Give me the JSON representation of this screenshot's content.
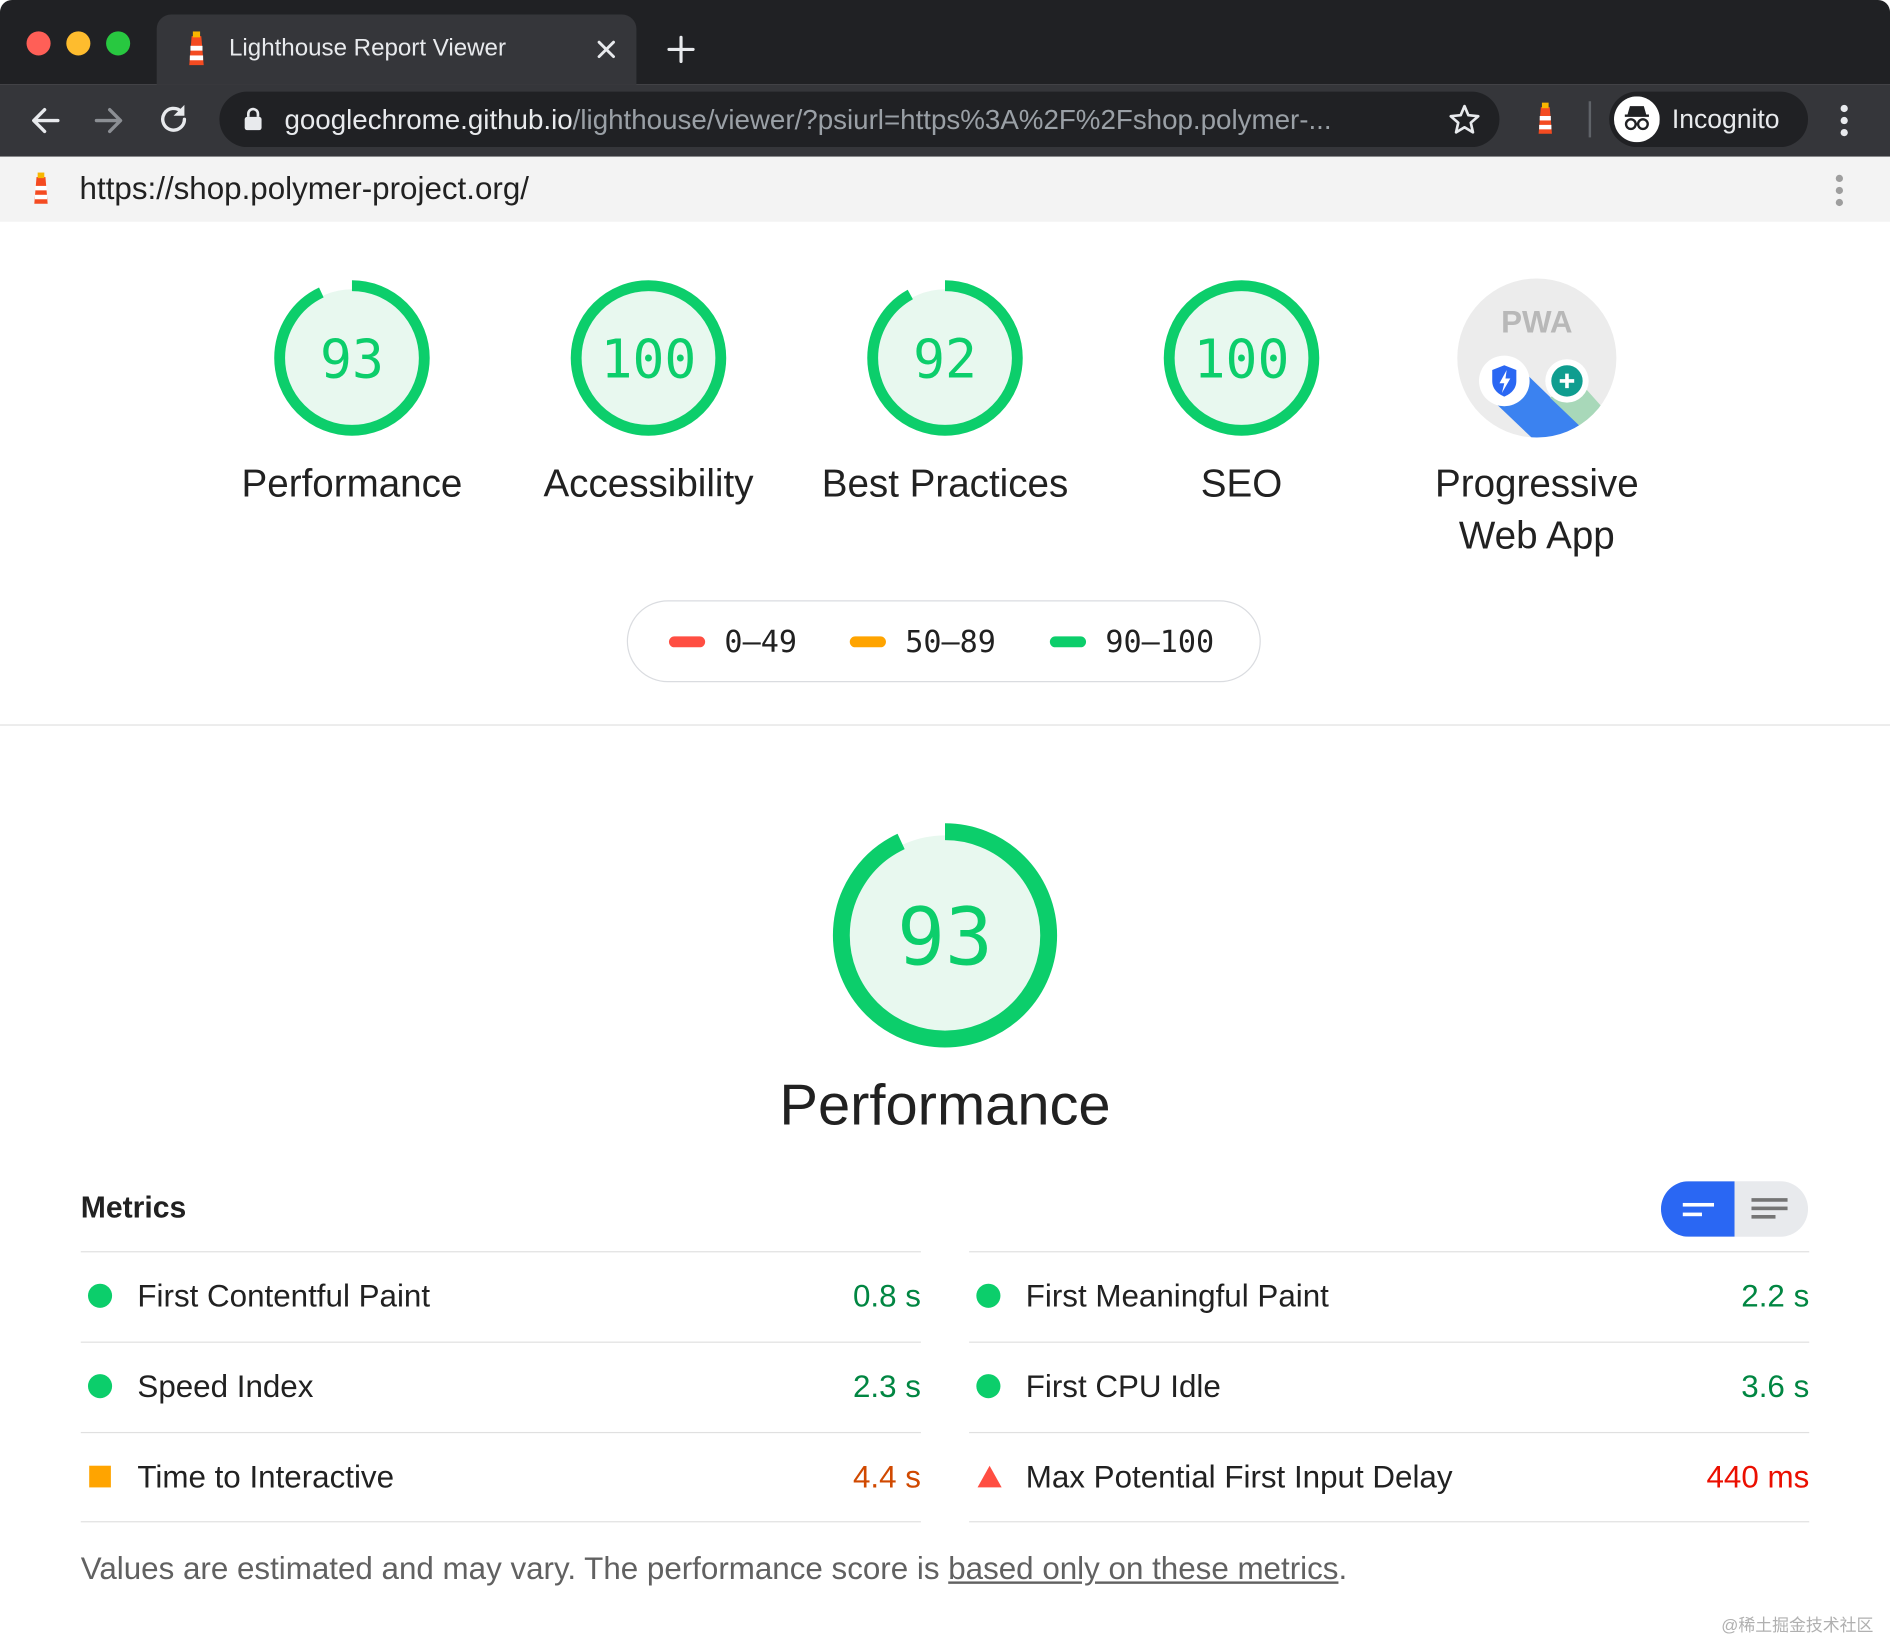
{
  "browser": {
    "tab_title": "Lighthouse Report Viewer",
    "url_host": "googlechrome.github.io",
    "url_rest": "/lighthouse/viewer/?psiurl=https%3A%2F%2Fshop.polymer-...",
    "incognito_label": "Incognito"
  },
  "report": {
    "page_url": "https://shop.polymer-project.org/",
    "gauges": [
      {
        "score": "93",
        "label": "Performance"
      },
      {
        "score": "100",
        "label": "Accessibility"
      },
      {
        "score": "92",
        "label": "Best Practices"
      },
      {
        "score": "100",
        "label": "SEO"
      }
    ],
    "pwa": {
      "badge": "PWA",
      "label_line1": "Progressive",
      "label_line2": "Web App"
    },
    "legend": [
      {
        "range": "0–49",
        "color": "#ff4e42"
      },
      {
        "range": "50–89",
        "color": "#ffa400"
      },
      {
        "range": "90–100",
        "color": "#0cce6b"
      }
    ],
    "main": {
      "score": "93",
      "title": "Performance"
    },
    "metrics_title": "Metrics",
    "metrics": [
      {
        "label": "First Contentful Paint",
        "value": "0.8 s",
        "status": "pass"
      },
      {
        "label": "First Meaningful Paint",
        "value": "2.2 s",
        "status": "pass"
      },
      {
        "label": "Speed Index",
        "value": "2.3 s",
        "status": "pass"
      },
      {
        "label": "First CPU Idle",
        "value": "3.6 s",
        "status": "pass"
      },
      {
        "label": "Time to Interactive",
        "value": "4.4 s",
        "status": "average"
      },
      {
        "label": "Max Potential First Input Delay",
        "value": "440 ms",
        "status": "fail"
      }
    ],
    "footnote_text": "Values are estimated and may vary. The performance score is ",
    "footnote_link": "based only on these metrics",
    "footnote_end": ".",
    "watermark": "@稀土掘金技术社区"
  },
  "colors": {
    "pass": "#0cce6b",
    "pass_text": "#018642",
    "average": "#ffa400",
    "average_text": "#d04900",
    "fail": "#ff4e42",
    "fail_text": "#eb0f00",
    "toggle_active": "#2a67f3"
  }
}
